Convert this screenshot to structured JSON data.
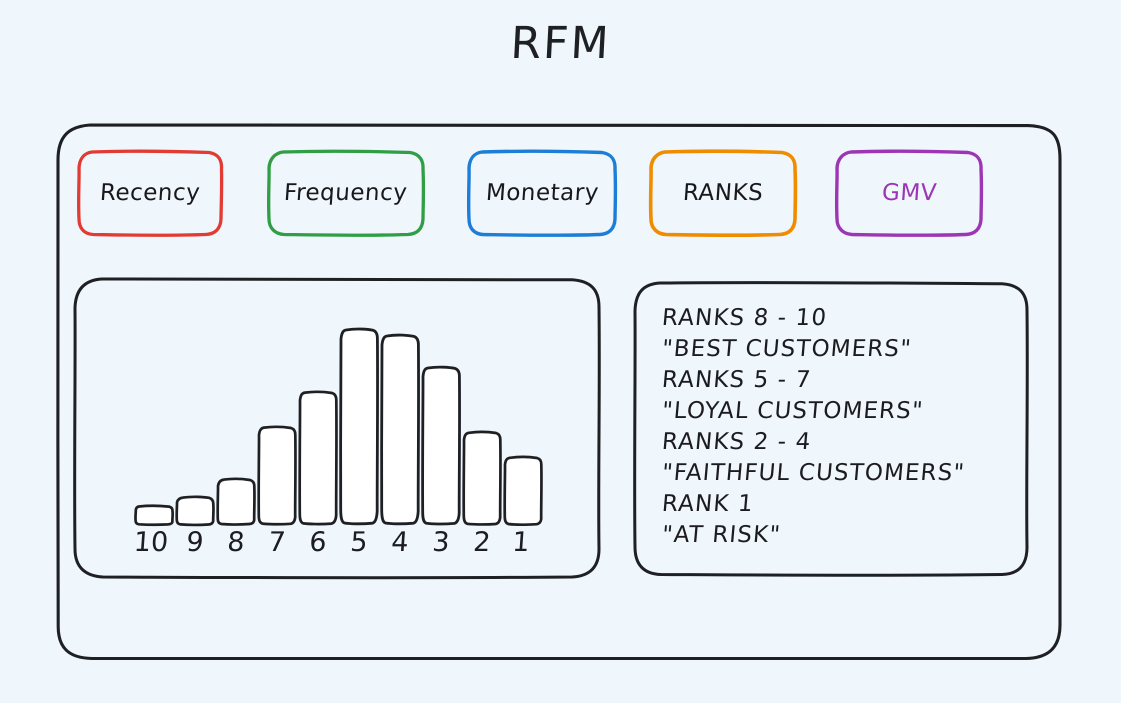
{
  "page": {
    "title": "RFM",
    "background_color": "#eff6fc",
    "ink_color": "#1f2024"
  },
  "tags": [
    {
      "label": "Recency",
      "color": "#e23b33",
      "text_color": "#19191c",
      "x": 0,
      "width": 148
    },
    {
      "label": "Frequency",
      "color": "#2f9e44",
      "text_color": "#19191c",
      "x": 190,
      "width": 160
    },
    {
      "label": "Monetary",
      "color": "#1c7ed6",
      "text_color": "#19191c",
      "x": 390,
      "width": 152
    },
    {
      "label": "RANKS",
      "color": "#f08c00",
      "text_color": "#19191c",
      "x": 572,
      "width": 150
    },
    {
      "label": "GMV",
      "color": "#9c36b5",
      "text_color": "#9c36b5",
      "x": 758,
      "width": 150
    }
  ],
  "legend": {
    "lines": [
      "RANKS 8 - 10",
      "\"BEST CUSTOMERS\"",
      "RANKS 5 - 7",
      "\"LOYAL CUSTOMERS\"",
      "RANKS 2 - 4",
      "\"FAITHFUL CUSTOMERS\"",
      "RANK 1",
      "\"AT RISK\""
    ]
  },
  "chart_data": {
    "type": "bar",
    "title": "RFM",
    "xlabel": "",
    "ylabel": "",
    "grid": false,
    "legend_position": "none",
    "categories": [
      "10",
      "9",
      "8",
      "7",
      "6",
      "5",
      "4",
      "3",
      "2",
      "1"
    ],
    "values": [
      21,
      30,
      48,
      100,
      135,
      198,
      192,
      160,
      95,
      70
    ],
    "ylim": [
      0,
      210
    ],
    "notes": "Distribution of customers across RFM ranks 10 (left) to 1 (right); unlabeled y-axis, values read as pixel bar heights."
  }
}
